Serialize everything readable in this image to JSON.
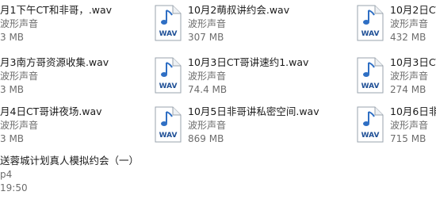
{
  "colors": {
    "icon_blue": "#2f6fc4",
    "wav_text": "#1e4f96",
    "secondary_text": "#6d6d6d",
    "primary_text": "#1a1a1a"
  },
  "icon": {
    "name": "wav-audio-file-icon",
    "badge_text": "WAV"
  },
  "files": [
    {
      "name": "月1下午CT和非哥，.wav",
      "type": "波形声音",
      "size": "3 MB",
      "has_icon": false
    },
    {
      "name": "10月2萌叔讲约会.wav",
      "type": "波形声音",
      "size": "307 MB",
      "has_icon": true
    },
    {
      "name": "10月2日CT",
      "type": "波形声音",
      "size": "432 MB",
      "has_icon": true
    },
    {
      "name": "月3南方哥资源收集.wav",
      "type": "波形声音",
      "size": "3 MB",
      "has_icon": false
    },
    {
      "name": "10月3日CT哥讲速约1.wav",
      "type": "波形声音",
      "size": "74.4 MB",
      "has_icon": true
    },
    {
      "name": "10月3日CT",
      "type": "波形声音",
      "size": "274 MB",
      "has_icon": true
    },
    {
      "name": "月4日CT哥讲夜场.wav",
      "type": "波形声音",
      "size": "3 MB",
      "has_icon": false
    },
    {
      "name": "10月5日非哥讲私密空间.wav",
      "type": "波形声音",
      "size": "869 MB",
      "has_icon": true
    },
    {
      "name": "10月6日非",
      "type": "波形声音",
      "size": "715 MB",
      "has_icon": true
    },
    {
      "name": "送蓉城计划真人模拟约会（一）",
      "type": "p4",
      "size": "19:50",
      "has_icon": false
    }
  ]
}
